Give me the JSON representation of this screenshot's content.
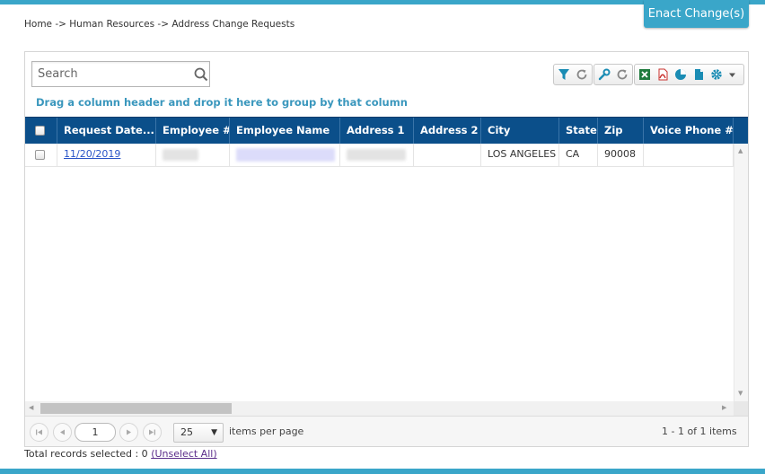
{
  "header": {
    "enact_button_label": "Enact Change(s)",
    "breadcrumb": "Home -> Human Resources -> Address Change Requests"
  },
  "search": {
    "placeholder": "Search",
    "value": ""
  },
  "toolbar": {
    "icons": [
      "filter-icon",
      "refresh-icon",
      "wrench-icon",
      "refresh-icon",
      "excel-icon",
      "pdf-icon",
      "chart-icon",
      "document-icon",
      "gear-icon",
      "dropdown-arrow-icon"
    ]
  },
  "grid": {
    "group_hint": "Drag a column header and drop it here to group by that column",
    "columns": [
      "Request Date...",
      "Employee #",
      "Employee Name",
      "Address 1",
      "Address 2",
      "City",
      "State",
      "Zip",
      "Voice Phone #"
    ],
    "rows": [
      {
        "request_date": "11/20/2019",
        "employee_number": "",
        "employee_name": "",
        "address1": "",
        "address2": "",
        "city": "LOS ANGELES",
        "state": "CA",
        "zip": "90008",
        "voice_phone": ""
      }
    ]
  },
  "pager": {
    "current_page": "1",
    "page_size": "25",
    "items_per_page_label": "items per page",
    "summary": "1 - 1 of 1 items"
  },
  "footer": {
    "total_label": "Total records selected : 0",
    "unselect_all": "(Unselect All)"
  },
  "colors": {
    "accent": "#3aa6c9",
    "header_bg": "#0b4f8a",
    "link": "#2a55c8",
    "hint": "#3a97bd"
  }
}
